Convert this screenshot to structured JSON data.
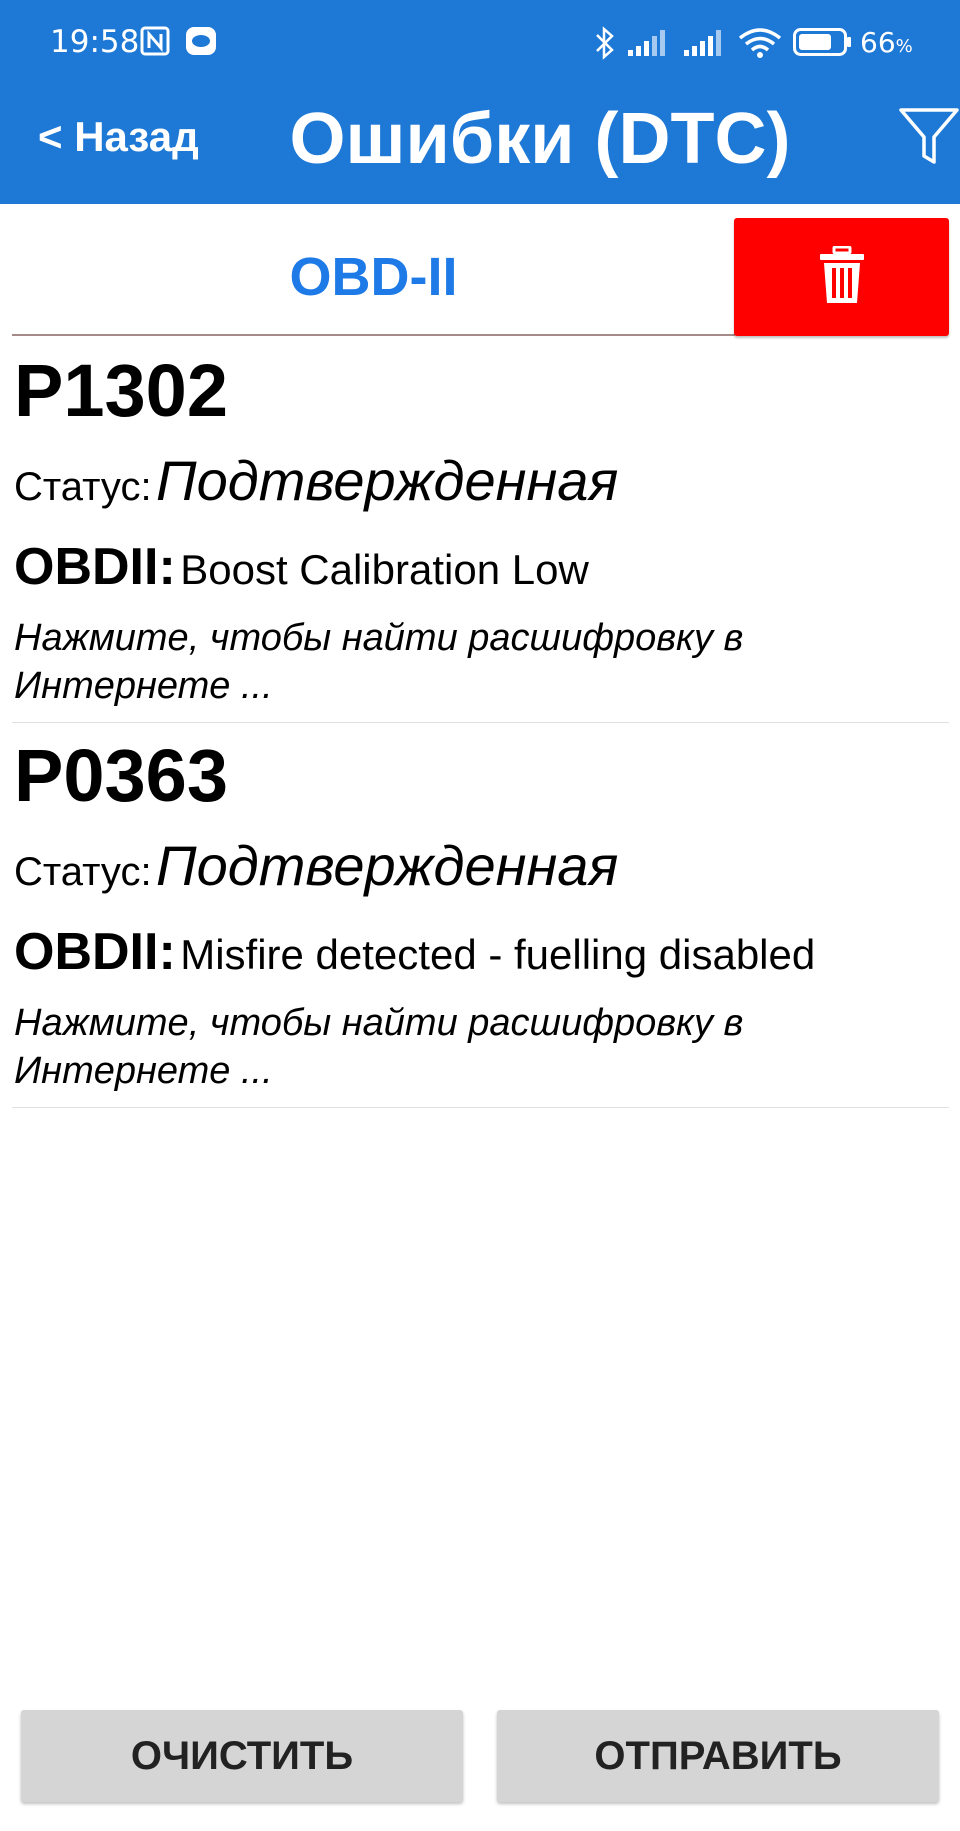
{
  "status_bar": {
    "time": "19:58",
    "battery_level": "66",
    "battery_unit": "%",
    "icons": [
      "nfc-icon",
      "chat-bubble-icon",
      "bluetooth-icon",
      "signal-icon",
      "signal-icon",
      "wifi-icon",
      "battery-icon"
    ]
  },
  "header": {
    "back_label": "< Назад",
    "title": "Ошибки (DTC)",
    "filter_icon": "filter-icon",
    "background_color": "#1e78d6"
  },
  "tabs": {
    "obd_label": "OBD-II",
    "delete_icon": "trash-icon",
    "delete_color": "#ff0000"
  },
  "dtc_list": [
    {
      "code": "P1302",
      "status_label": "Статус:",
      "status_value": "Подтвержденная",
      "desc_label": "OBDII:",
      "desc_value": "Boost Calibration Low",
      "hint": "Нажмите, чтобы найти расшифровку в Интернете ..."
    },
    {
      "code": "P0363",
      "status_label": "Статус:",
      "status_value": "Подтвержденная",
      "desc_label": "OBDII:",
      "desc_value": "Misfire detected - fuelling disabled",
      "hint": "Нажмите, чтобы найти расшифровку в Интернете ..."
    }
  ],
  "actions": {
    "clear_label": "ОЧИСТИТЬ",
    "send_label": "ОТПРАВИТЬ"
  }
}
